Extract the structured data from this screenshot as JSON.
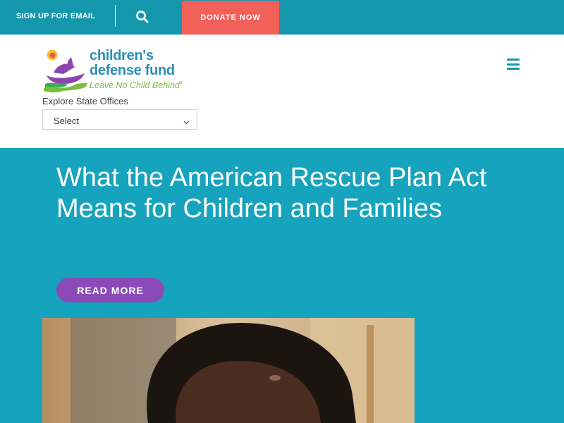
{
  "topbar": {
    "signup_label": "SIGN UP FOR EMAIL",
    "search_icon": "search-icon",
    "donate_label": "DONATE NOW",
    "colors": {
      "bar": "#1496ad",
      "donate": "#f2605a"
    }
  },
  "header": {
    "logo": {
      "line1": "children's",
      "line2": "defense fund",
      "tagline": "Leave No Child Behind",
      "tagline_mark": "®"
    },
    "menu_icon": "hamburger-menu-icon",
    "state_offices": {
      "label": "Explore State Offices",
      "selected": "Select",
      "chevron_icon": "chevron-down-icon"
    }
  },
  "hero": {
    "title": "What the American Rescue Plan Act Means for Children and Families",
    "button_label": "READ MORE",
    "photo": "child-photo",
    "colors": {
      "background": "#16a3bd",
      "button": "#8a4bb8"
    }
  }
}
